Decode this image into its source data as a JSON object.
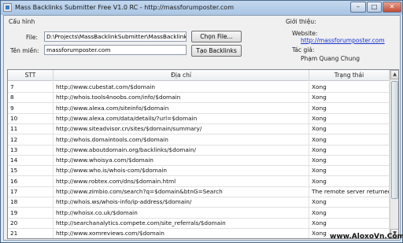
{
  "window": {
    "title": "Mass Backlinks Submitter Free V1.0 RC - http://massforumposter.com"
  },
  "controls": {
    "minimize": "–",
    "maximize": "□",
    "close": "✕"
  },
  "config": {
    "group_title": "Cấu hình",
    "file_label": "File:",
    "file_value": "D:\\Projects\\MassBacklinkSubmitter\\MassBacklinkSub",
    "choose_file_button": "Chọn File...",
    "domain_label": "Tên miền:",
    "domain_value": "massforumposter.com",
    "create_backlinks_button": "Tạo Backlinks"
  },
  "intro": {
    "group_title": "Giới thiệu:",
    "website_label": "Website:",
    "website_url": "http://massforumposter.com",
    "author_label": "Tác giả:",
    "author_name": "Phạm Quang Chung"
  },
  "table": {
    "columns": [
      "STT",
      "Địa chỉ",
      "Trạng thái"
    ],
    "rows": [
      [
        "7",
        "http://www.cubestat.com/$domain",
        "Xong"
      ],
      [
        "8",
        "http://whois.tools4noobs.com/info/$domain",
        "Xong"
      ],
      [
        "9",
        "http://www.alexa.com/siteinfo/$domain",
        "Xong"
      ],
      [
        "10",
        "http://www.alexa.com/data/details/?url=$domain",
        "Xong"
      ],
      [
        "11",
        "http://www.siteadvisor.cn/sites/$domain/summary/",
        "Xong"
      ],
      [
        "12",
        "http://whois.domaintools.com/$domain",
        "Xong"
      ],
      [
        "13",
        "http://www.aboutdomain.org/backlinks/$domain/",
        "Xong"
      ],
      [
        "14",
        "http://www.whoisya.com/$domain",
        "Xong"
      ],
      [
        "15",
        "http://www.who.is/whois-com/$domain",
        "Xong"
      ],
      [
        "16",
        "http://www.robtex.com/dns/$domain.html",
        "Xong"
      ],
      [
        "17",
        "http://www.zimbio.com/search?q=$domain&btnG=Search",
        "The remote server returned ..."
      ],
      [
        "18",
        "http://whois.ws/whois-info/ip-address/$domain/",
        "Xong"
      ],
      [
        "19",
        "http://whoisx.co.uk/$domain",
        "Xong"
      ],
      [
        "20",
        "http://searchanalytics.compete.com/site_referrals/$domain",
        "Xong"
      ],
      [
        "21",
        "http://www.xomreviews.com/$domain",
        "Xong"
      ]
    ]
  },
  "watermark": "www.AloxoVn.Com"
}
